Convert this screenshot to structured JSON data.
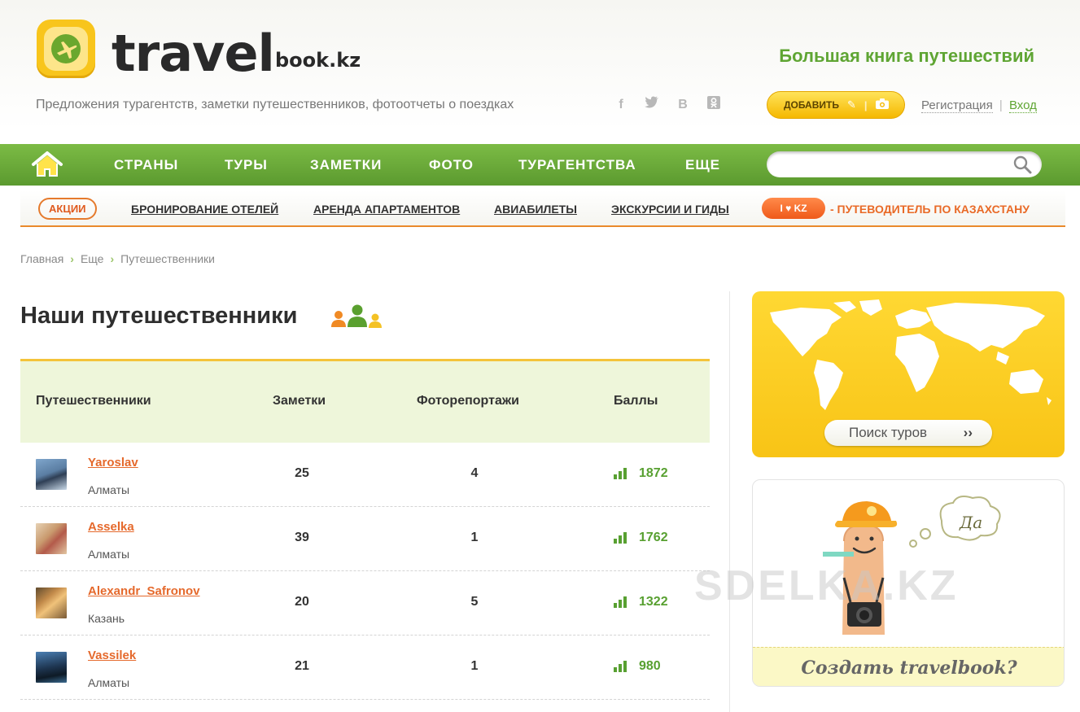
{
  "header": {
    "logo_word": "travel",
    "logo_domain": "book.kz",
    "slogan": "Большая книга путешествий",
    "tagline": "Предложения турагентств, заметки путешественников, фотоотчеты о поездках",
    "socials": [
      "f",
      "twitter-icon",
      "В",
      "odnoklassniki-icon"
    ],
    "add_button": "ДОБАВИТЬ",
    "register": "Регистрация",
    "auth_separator": "|",
    "login": "Вход"
  },
  "mainnav": {
    "items": [
      "СТРАНЫ",
      "ТУРЫ",
      "ЗАМЕТКИ",
      "ФОТО",
      "ТУРАГЕНТСТВА",
      "ЕЩЕ"
    ],
    "search_placeholder": ""
  },
  "subnav": {
    "promo_label": "АКЦИИ",
    "links": [
      "БРОНИРОВАНИЕ ОТЕЛЕЙ",
      "АРЕНДА АПАРТАМЕНТОВ",
      "АВИАБИЛЕТЫ",
      "ЭКСКУРСИИ И ГИДЫ"
    ],
    "kz_badge": "I ♥ KZ",
    "kz_guide": "- ПУТЕВОДИТЕЛЬ ПО КАЗАХСТАНУ"
  },
  "breadcrumb": {
    "items": [
      "Главная",
      "Еще",
      "Путешественники"
    ],
    "separator": "›"
  },
  "page_title": "Наши путешественники",
  "table": {
    "headers": [
      "Путешественники",
      "Заметки",
      "Фоторепортажи",
      "Баллы"
    ],
    "rows": [
      {
        "name": "Yaroslav",
        "city": "Алматы",
        "notes": "25",
        "photos": "4",
        "score": "1872"
      },
      {
        "name": "Asselka",
        "city": "Алматы",
        "notes": "39",
        "photos": "1",
        "score": "1762"
      },
      {
        "name": "Alexandr_Safronov",
        "city": "Казань",
        "notes": "20",
        "photos": "5",
        "score": "1322"
      },
      {
        "name": "Vassilek",
        "city": "Алматы",
        "notes": "21",
        "photos": "1",
        "score": "980"
      }
    ]
  },
  "sidebar": {
    "tour_search": "Поиск туров",
    "tour_search_arrow": "››",
    "promo_bubble": "Да",
    "promo_cta": "Создать travelbook?"
  },
  "watermark": "SDELKA.KZ",
  "colors": {
    "green": "#5fa533",
    "orange": "#e5692c",
    "yellow": "#f8c416"
  }
}
